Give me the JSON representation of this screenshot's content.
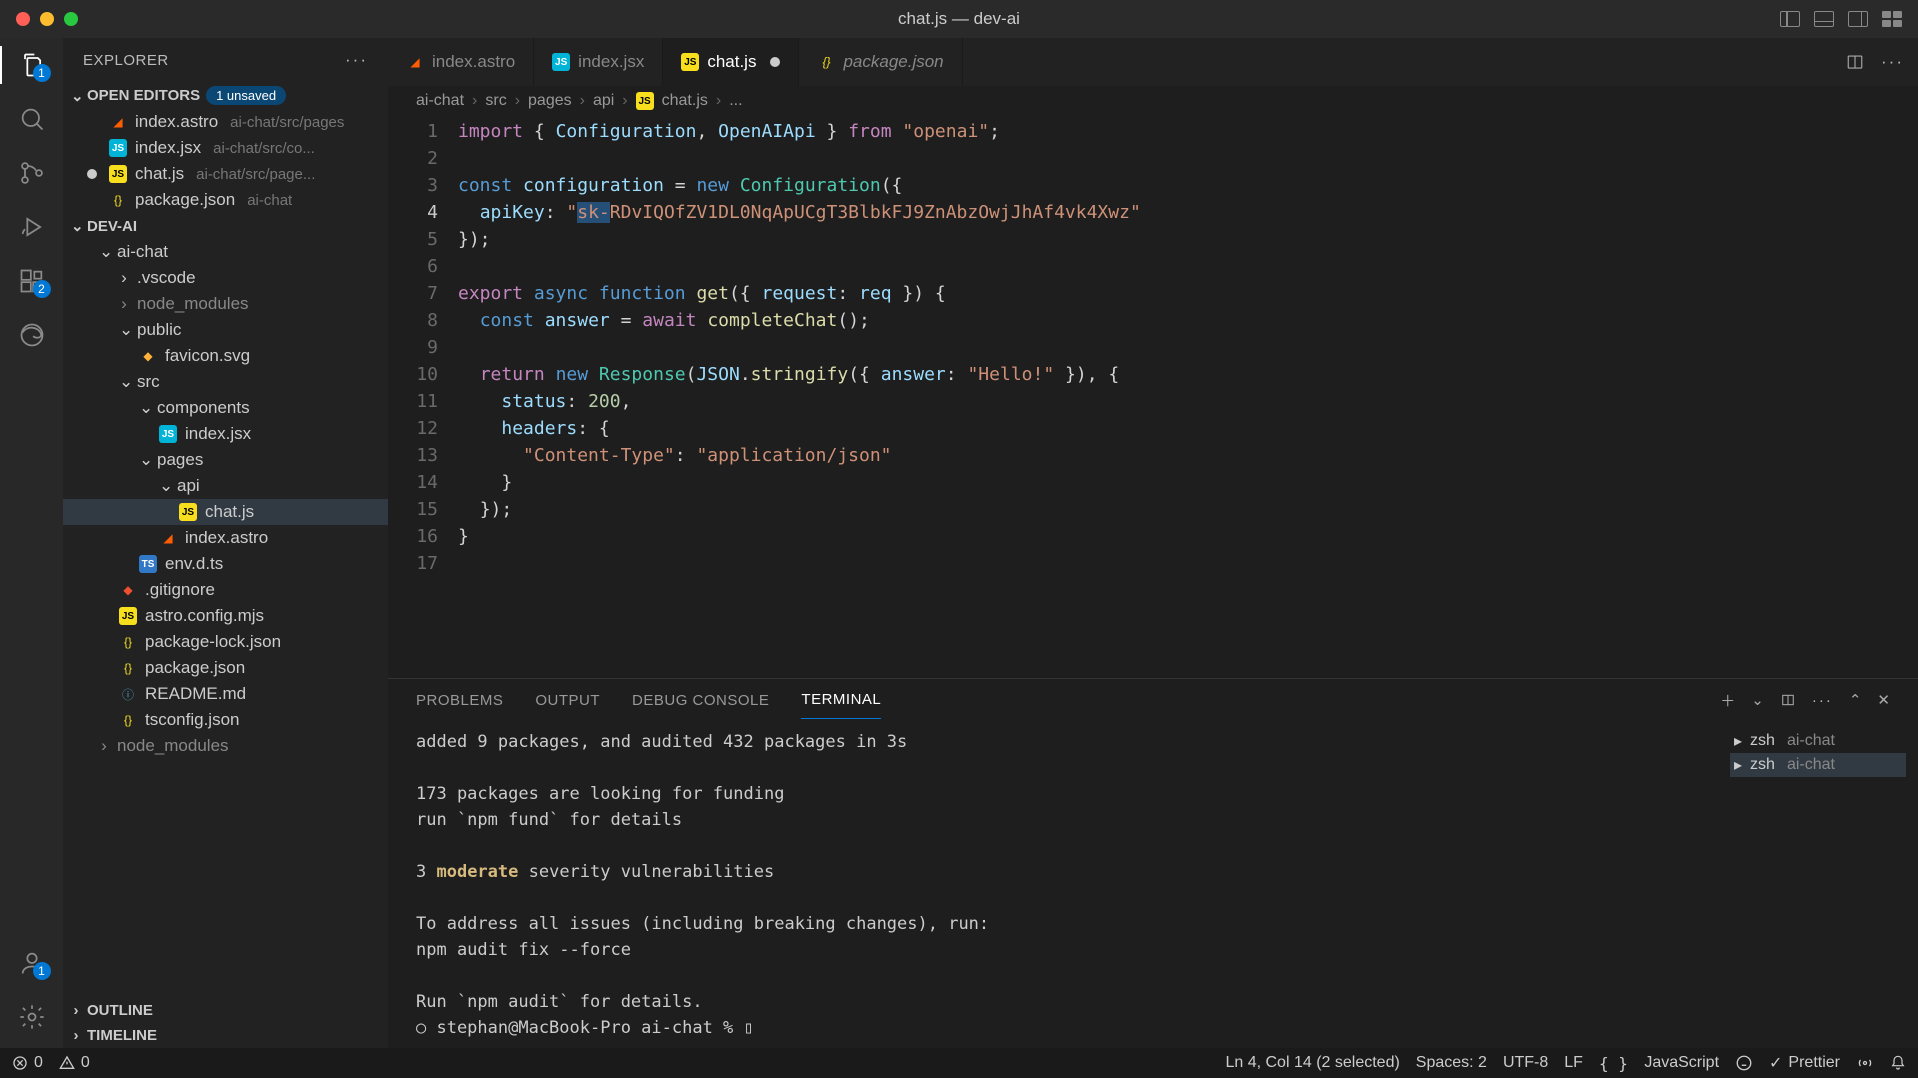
{
  "window": {
    "title": "chat.js — dev-ai"
  },
  "sidebar": {
    "title": "EXPLORER",
    "open_editors_label": "OPEN EDITORS",
    "unsaved_badge": "1 unsaved",
    "open_editors": [
      {
        "name": "index.astro",
        "path": "ai-chat/src/pages"
      },
      {
        "name": "index.jsx",
        "path": "ai-chat/src/co..."
      },
      {
        "name": "chat.js",
        "path": "ai-chat/src/page...",
        "modified": true
      },
      {
        "name": "package.json",
        "path": "ai-chat"
      }
    ],
    "project_name": "DEV-AI",
    "outline_label": "OUTLINE",
    "timeline_label": "TIMELINE",
    "tree": {
      "ai_chat": "ai-chat",
      "vscode": ".vscode",
      "node_modules": "node_modules",
      "public": "public",
      "favicon": "favicon.svg",
      "src": "src",
      "components": "components",
      "index_jsx": "index.jsx",
      "pages": "pages",
      "api": "api",
      "chat_js": "chat.js",
      "index_astro": "index.astro",
      "env_dts": "env.d.ts",
      "gitignore": ".gitignore",
      "astro_config": "astro.config.mjs",
      "package_lock": "package-lock.json",
      "package_json": "package.json",
      "readme": "README.md",
      "tsconfig": "tsconfig.json",
      "node_modules2": "node_modules"
    }
  },
  "tabs": [
    {
      "name": "index.astro",
      "icon": "astro"
    },
    {
      "name": "index.jsx",
      "icon": "jsx"
    },
    {
      "name": "chat.js",
      "icon": "js",
      "active": true,
      "modified": true
    },
    {
      "name": "package.json",
      "icon": "json",
      "italic": true
    }
  ],
  "breadcrumb": {
    "parts": [
      "ai-chat",
      "src",
      "pages",
      "api",
      "chat.js",
      "..."
    ]
  },
  "code": {
    "lines": [
      {
        "n": 1,
        "html": "<span class='tok-kw2'>import</span> <span class='tok-punc'>{</span> <span class='tok-var'>Configuration</span><span class='tok-punc'>,</span> <span class='tok-var'>OpenAIApi</span> <span class='tok-punc'>}</span> <span class='tok-kw2'>from</span> <span class='tok-str'>\"openai\"</span><span class='tok-punc'>;</span>"
      },
      {
        "n": 2,
        "html": ""
      },
      {
        "n": 3,
        "html": "<span class='tok-kw'>const</span> <span class='tok-var'>configuration</span> <span class='tok-punc'>=</span> <span class='tok-kw'>new</span> <span class='tok-type'>Configuration</span><span class='tok-punc'>({</span>"
      },
      {
        "n": 4,
        "current": true,
        "html": "  <span class='tok-var'>apiKey</span><span class='tok-punc'>:</span> <span class='tok-str'>\"<span class='sel'>sk-</span>RDvIQOfZV1DL0NqApUCgT3BlbkFJ9ZnAbzOwjJhAf4vk4Xwz\"</span>"
      },
      {
        "n": 5,
        "html": "<span class='tok-punc'>});</span>"
      },
      {
        "n": 6,
        "html": ""
      },
      {
        "n": 7,
        "html": "<span class='tok-kw2'>export</span> <span class='tok-kw'>async</span> <span class='tok-kw'>function</span> <span class='tok-fn'>get</span><span class='tok-punc'>({</span> <span class='tok-param'>request</span><span class='tok-punc'>:</span> <span class='tok-var'>req</span> <span class='tok-punc'>}) {</span>"
      },
      {
        "n": 8,
        "html": "  <span class='tok-kw'>const</span> <span class='tok-var'>answer</span> <span class='tok-punc'>=</span> <span class='tok-kw2'>await</span> <span class='tok-fn'>completeChat</span><span class='tok-punc'>();</span>"
      },
      {
        "n": 9,
        "html": ""
      },
      {
        "n": 10,
        "html": "  <span class='tok-kw2'>return</span> <span class='tok-kw'>new</span> <span class='tok-type'>Response</span><span class='tok-punc'>(</span><span class='tok-var'>JSON</span><span class='tok-punc'>.</span><span class='tok-fn'>stringify</span><span class='tok-punc'>({</span> <span class='tok-var'>answer</span><span class='tok-punc'>:</span> <span class='tok-str'>\"Hello!\"</span> <span class='tok-punc'>}), {</span>"
      },
      {
        "n": 11,
        "html": "    <span class='tok-var'>status</span><span class='tok-punc'>:</span> <span class='tok-num'>200</span><span class='tok-punc'>,</span>"
      },
      {
        "n": 12,
        "html": "    <span class='tok-var'>headers</span><span class='tok-punc'>: {</span>"
      },
      {
        "n": 13,
        "html": "      <span class='tok-str'>\"Content-Type\"</span><span class='tok-punc'>:</span> <span class='tok-str'>\"application/json\"</span>"
      },
      {
        "n": 14,
        "html": "    <span class='tok-punc'>}</span>"
      },
      {
        "n": 15,
        "html": "  <span class='tok-punc'>});</span>"
      },
      {
        "n": 16,
        "html": "<span class='tok-punc'>}</span>"
      },
      {
        "n": 17,
        "html": ""
      }
    ]
  },
  "panel": {
    "tabs": {
      "problems": "PROBLEMS",
      "output": "OUTPUT",
      "debug": "DEBUG CONSOLE",
      "terminal": "TERMINAL"
    },
    "terminal_lines": [
      "added 9 packages, and audited 432 packages in 3s",
      "",
      "173 packages are looking for funding",
      "  run `npm fund` for details",
      "",
      "3 <span class='mod'>moderate</span> severity vulnerabilities",
      "",
      "To address all issues (including breaking changes), run:",
      "  npm audit fix --force",
      "",
      "Run `npm audit` for details.",
      "○ stephan@MacBook-Pro ai-chat % ▯"
    ],
    "terminals": [
      {
        "shell": "zsh",
        "dir": "ai-chat"
      },
      {
        "shell": "zsh",
        "dir": "ai-chat",
        "active": true
      }
    ]
  },
  "statusbar": {
    "errors": "0",
    "warnings": "0",
    "cursor": "Ln 4, Col 14 (2 selected)",
    "spaces": "Spaces: 2",
    "encoding": "UTF-8",
    "eol": "LF",
    "lang": "JavaScript",
    "prettier": "Prettier"
  },
  "activity_badges": {
    "explorer": "1",
    "extensions": "2",
    "account": "1"
  }
}
